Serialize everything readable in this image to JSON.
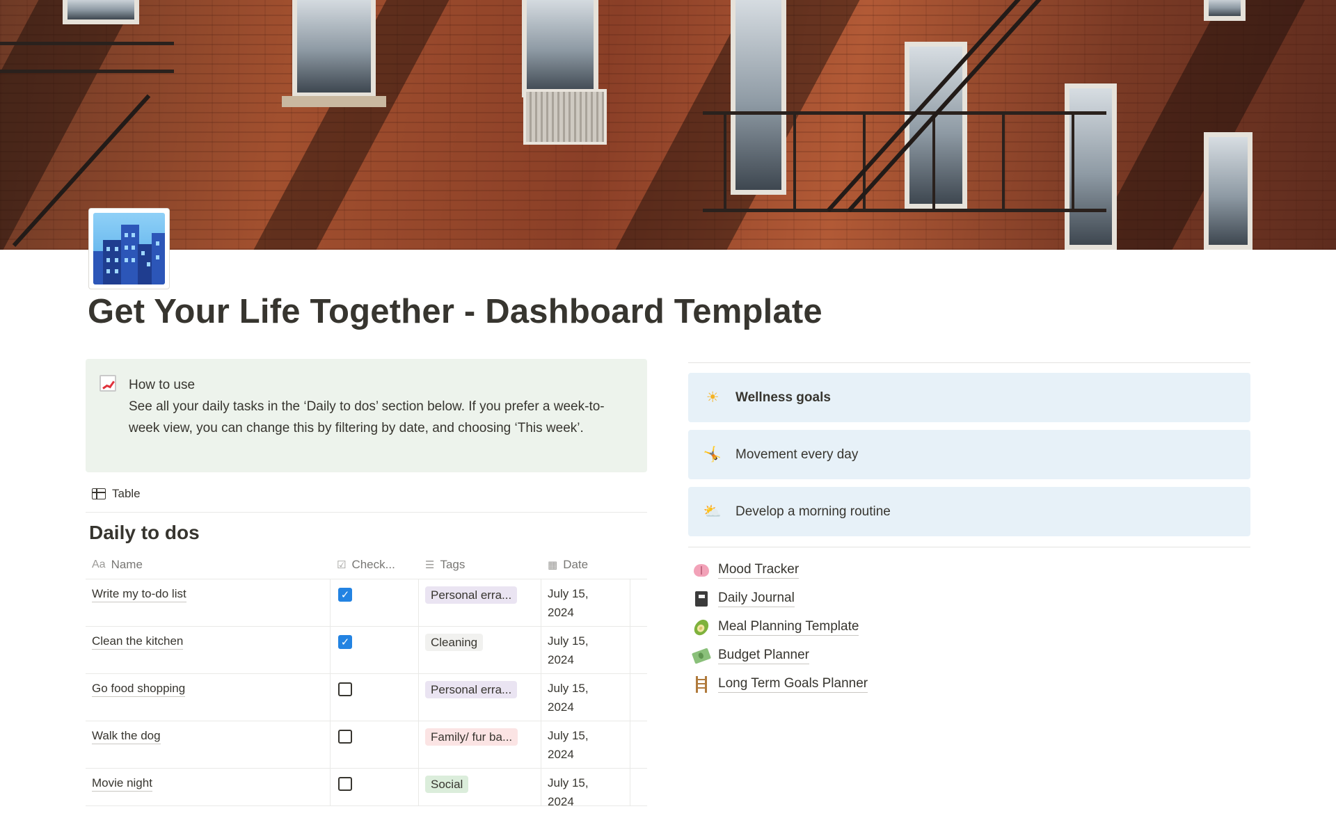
{
  "page": {
    "title": "Get Your Life Together - Dashboard Template",
    "cover_alt": "Red brick building facade with fire escapes",
    "icon": "cityscape-icon"
  },
  "callout": {
    "icon": "chart-increasing-icon",
    "heading": "How to use",
    "body": "See all your daily tasks in the ‘Daily to dos’ section below. If you prefer a week-to-week view, you can change this by filtering by date, and choosing ‘This week’."
  },
  "view": {
    "label": "Table",
    "icon": "table-icon"
  },
  "database": {
    "title": "Daily to dos",
    "columns": [
      {
        "label": "Name",
        "icon": "text-property-icon"
      },
      {
        "label": "Check...",
        "icon": "checkbox-property-icon"
      },
      {
        "label": "Tags",
        "icon": "multi-select-property-icon"
      },
      {
        "label": "Date",
        "icon": "calendar-property-icon"
      }
    ],
    "rows": [
      {
        "name": "Write my to-do list",
        "checked": true,
        "tag": "Personal erra...",
        "tag_color": "#eae4f2",
        "date_line1": "July 15,",
        "date_line2": "2024"
      },
      {
        "name": "Clean the kitchen",
        "checked": true,
        "tag": "Cleaning",
        "tag_color": "#f1f1ef",
        "date_line1": "July 15,",
        "date_line2": "2024"
      },
      {
        "name": "Go food shopping",
        "checked": false,
        "tag": "Personal erra...",
        "tag_color": "#eae4f2",
        "date_line1": "July 15,",
        "date_line2": "2024"
      },
      {
        "name": "Walk the dog",
        "checked": false,
        "tag": "Family/ fur ba...",
        "tag_color": "#fbe4e4",
        "date_line1": "July 15,",
        "date_line2": "2024"
      },
      {
        "name": "Movie night",
        "checked": false,
        "tag": "Social",
        "tag_color": "#dbeddb",
        "date_line1": "July 15,",
        "date_line2": "2024"
      }
    ]
  },
  "goals": [
    {
      "label": "Wellness goals",
      "icon": "sun-icon",
      "glyph": "☀"
    },
    {
      "label": "Movement every day",
      "icon": "gymnast-icon",
      "glyph": "🤸"
    },
    {
      "label": "Develop a morning routine",
      "icon": "sun-behind-cloud-icon",
      "glyph": "⛅"
    }
  ],
  "links": [
    {
      "label": "Mood Tracker",
      "icon": "brain-icon"
    },
    {
      "label": "Daily Journal",
      "icon": "notebook-icon"
    },
    {
      "label": "Meal Planning Template",
      "icon": "avocado-icon"
    },
    {
      "label": "Budget Planner",
      "icon": "money-with-wings-icon"
    },
    {
      "label": "Long Term Goals Planner",
      "icon": "ladder-icon"
    }
  ],
  "colors": {
    "callout_bg": "#edf3ec",
    "goal_bg": "#e7f1f8",
    "checkbox_checked": "#2383e2",
    "text": "#37352f",
    "muted": "#787774"
  }
}
